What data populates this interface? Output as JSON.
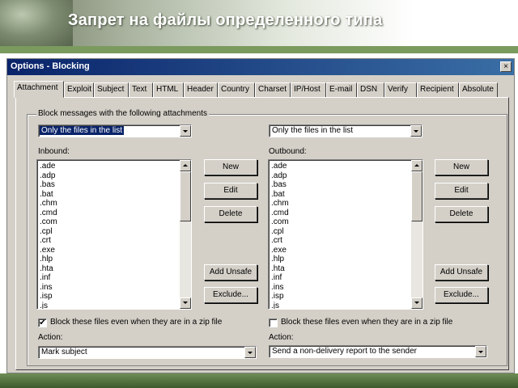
{
  "slide": {
    "title": "Запрет на файлы определенного типа"
  },
  "window": {
    "title": "Options - Blocking",
    "close_glyph": "×"
  },
  "tabs": [
    "Attachment",
    "Exploit",
    "Subject",
    "Text",
    "HTML",
    "Header",
    "Country",
    "Charset",
    "IP/Host",
    "E-mail",
    "DSN",
    "Verify",
    "Recipient",
    "Absolute"
  ],
  "active_tab": "Attachment",
  "group": {
    "legend": "Block messages with the following attachments"
  },
  "inbound": {
    "mode": "Only the files in the list",
    "label": "Inbound:",
    "items": [
      ".ade",
      ".adp",
      ".bas",
      ".bat",
      ".chm",
      ".cmd",
      ".com",
      ".cpl",
      ".crt",
      ".exe",
      ".hlp",
      ".hta",
      ".inf",
      ".ins",
      ".isp",
      ".js"
    ],
    "buttons": {
      "new": "New",
      "edit": "Edit",
      "delete": "Delete",
      "add_unsafe": "Add Unsafe",
      "exclude": "Exclude..."
    },
    "zip_checkbox": {
      "label": "Block these files even when they are in a zip file",
      "checked": true,
      "mark": "✔"
    },
    "action_label": "Action:",
    "action_value": "Mark subject"
  },
  "outbound": {
    "mode": "Only the files in the list",
    "label": "Outbound:",
    "items": [
      ".ade",
      ".adp",
      ".bas",
      ".bat",
      ".chm",
      ".cmd",
      ".com",
      ".cpl",
      ".crt",
      ".exe",
      ".hlp",
      ".hta",
      ".inf",
      ".ins",
      ".isp",
      ".js"
    ],
    "buttons": {
      "new": "New",
      "edit": "Edit",
      "delete": "Delete",
      "add_unsafe": "Add Unsafe",
      "exclude": "Exclude..."
    },
    "zip_checkbox": {
      "label": "Block these files even when they are in a zip file",
      "checked": false,
      "mark": ""
    },
    "action_label": "Action:",
    "action_value": "Send a non-delivery report to the sender"
  }
}
